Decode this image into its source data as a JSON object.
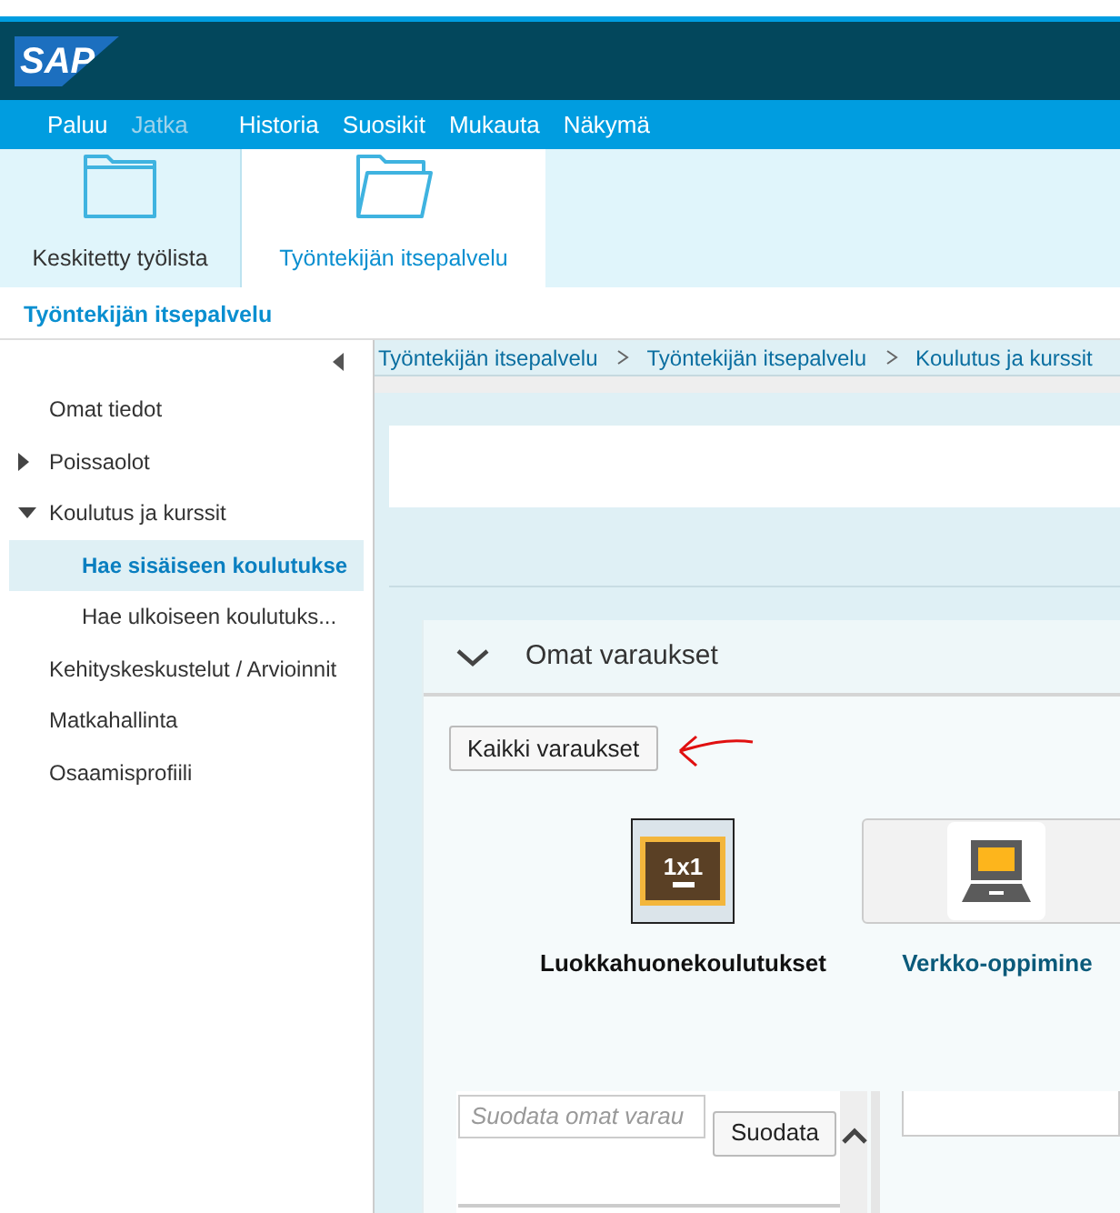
{
  "header": {
    "logo": "SAP"
  },
  "menu": [
    {
      "label": "Paluu",
      "disabled": false
    },
    {
      "label": "Jatka",
      "disabled": true
    },
    {
      "label": "Historia",
      "disabled": false
    },
    {
      "label": "Suosikit",
      "disabled": false
    },
    {
      "label": "Mukauta",
      "disabled": false
    },
    {
      "label": "Näkymä",
      "disabled": false
    }
  ],
  "tabs": [
    {
      "label": "Keskitetty työlista",
      "selected": false
    },
    {
      "label": "Työntekijän itsepalvelu",
      "selected": true
    }
  ],
  "page_title": "Työntekijän itsepalvelu",
  "sidebar": {
    "items": [
      {
        "label": "Omat tiedot",
        "selected": false
      },
      {
        "label": "Poissaolot",
        "selected": false,
        "expanded": false
      },
      {
        "label": "Koulutus ja kurssit",
        "selected": false,
        "expanded": true,
        "children": [
          {
            "label": "Hae sisäiseen koulutukse",
            "selected": true
          },
          {
            "label": "Hae ulkoiseen koulutuks...",
            "selected": false
          }
        ]
      },
      {
        "label": "Kehityskeskustelut / Arvioinnit",
        "selected": false
      },
      {
        "label": "Matkahallinta",
        "selected": false
      },
      {
        "label": "Osaamisprofiili",
        "selected": false
      }
    ]
  },
  "breadcrumb": [
    "Työntekijän itsepalvelu",
    "Työntekijän itsepalvelu",
    "Koulutus ja kurssit"
  ],
  "panel": {
    "title": "Omat varaukset",
    "expanded": true,
    "button": "Kaikki varaukset",
    "tiles": [
      {
        "label": "Luokkahuonekoulutukset",
        "kind": "classroom",
        "selected": true,
        "icon_text": "1x1"
      },
      {
        "label": "Verkko-oppimine",
        "kind": "elearning",
        "selected": false
      }
    ],
    "filter": {
      "placeholder": "Suodata omat varau",
      "button": "Suodata"
    }
  }
}
